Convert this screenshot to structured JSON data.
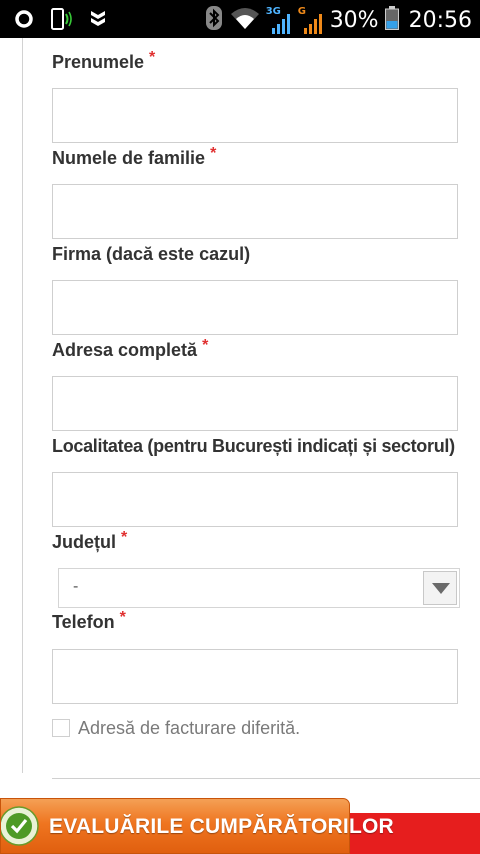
{
  "status_bar": {
    "network1_type": "3G",
    "network2_type": "G",
    "battery_percent": "30%",
    "time": "20:56"
  },
  "form": {
    "first_name_label": "Prenumele",
    "last_name_label": "Numele de familie",
    "company_label": "Firma (dacă este cazul)",
    "address_label": "Adresa completă",
    "city_label": "Localitatea (pentru București indicați și sectorul)",
    "county_label": "Județul",
    "county_selected": "-",
    "phone_label": "Telefon",
    "required_marker": "*",
    "billing_checkbox_label": "Adresă de facturare diferită.",
    "billing_checkbox_checked": false
  },
  "review_badge": {
    "label": "EVALUĂRILE CUMPĂRĂTORILOR"
  },
  "colors": {
    "required": "#e03030",
    "badge_orange": "#ef7520",
    "strip_red": "#e61e1e"
  }
}
